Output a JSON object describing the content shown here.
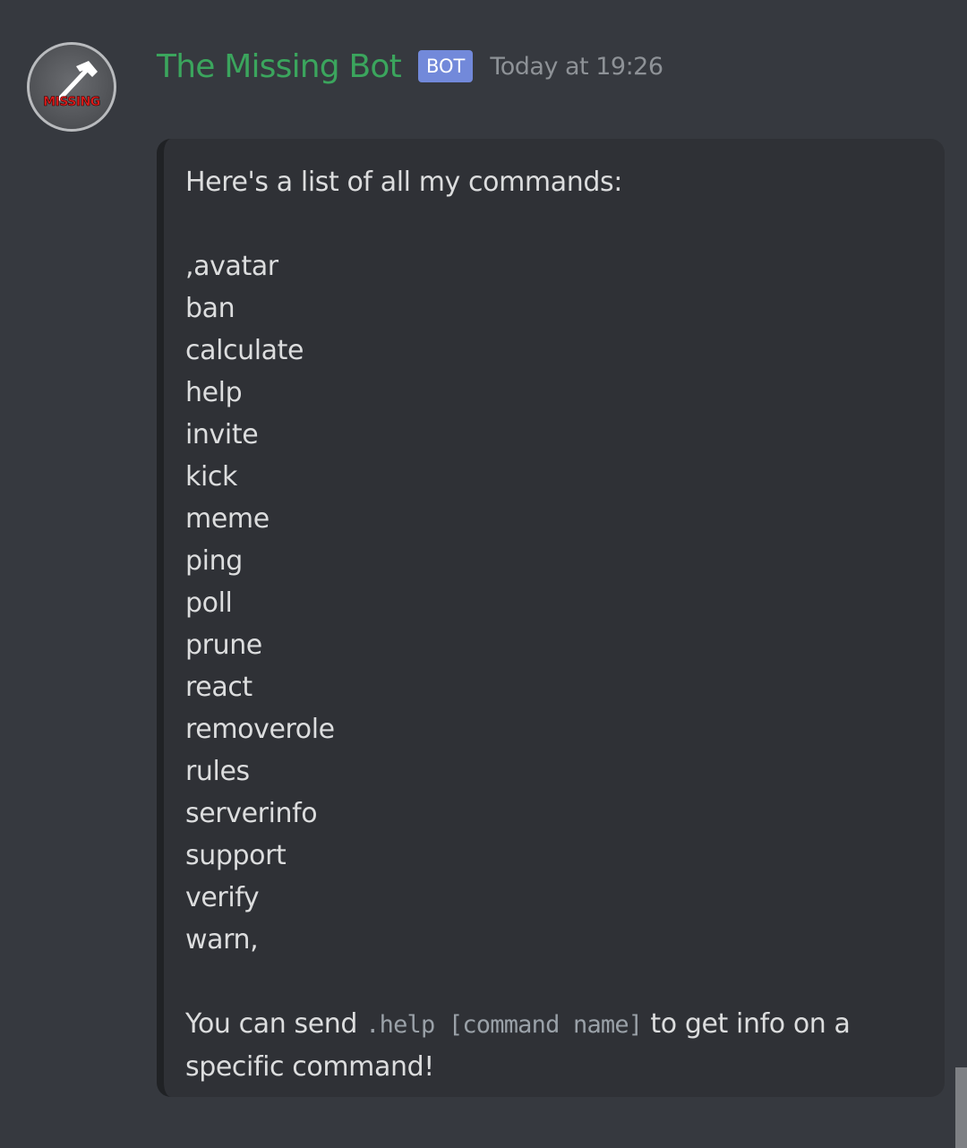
{
  "message": {
    "author": {
      "username": "The Missing Bot",
      "bot_tag": "BOT",
      "avatar_text": "MISSING",
      "avatar_icon": "hammer-icon",
      "username_color": "#3ba55d"
    },
    "timestamp": "Today at 19:26",
    "embed": {
      "intro": "Here's a list of all my commands:",
      "commands": [
        ",avatar",
        "ban",
        "calculate",
        "help",
        "invite",
        "kick",
        "meme",
        "ping",
        "poll",
        "prune",
        "react",
        "removerole",
        "rules",
        "serverinfo",
        "support",
        "verify",
        "warn,"
      ],
      "footer_prefix": "You can send ",
      "footer_code": ".help [command name]",
      "footer_suffix": " to get info on a specific command!"
    }
  },
  "colors": {
    "background": "#36393f",
    "embed_background": "#2f3136",
    "bot_tag": "#7289da",
    "text": "#dcddde",
    "timestamp": "#8e9297"
  }
}
